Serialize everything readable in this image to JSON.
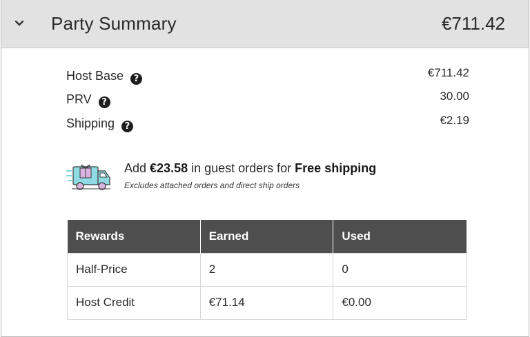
{
  "header": {
    "title": "Party Summary",
    "total": "€711.42"
  },
  "lines": [
    {
      "label": "Host Base",
      "value": "€711.42"
    },
    {
      "label": "PRV",
      "value": "30.00"
    },
    {
      "label": "Shipping",
      "value": "€2.19"
    }
  ],
  "help_glyph": "?",
  "promo": {
    "prefix": "Add ",
    "amount": "€23.58",
    "middle": " in guest orders for ",
    "emphasis": "Free shipping",
    "note": "Excludes attached orders and direct ship orders",
    "icon": "gift-delivery-van-icon",
    "icon_colors": {
      "van": "#7fd6df",
      "gift": "#d9b3e0",
      "outline": "#3a3a3a"
    }
  },
  "rewards_table": {
    "headers": [
      "Rewards",
      "Earned",
      "Used"
    ],
    "rows": [
      [
        "Half-Price",
        "2",
        "0"
      ],
      [
        "Host Credit",
        "€71.14",
        "€0.00"
      ]
    ],
    "header_bg": "#4e4e4e"
  },
  "colors": {
    "header_bg": "#e2e2e2",
    "text": "#2a2a2a"
  }
}
